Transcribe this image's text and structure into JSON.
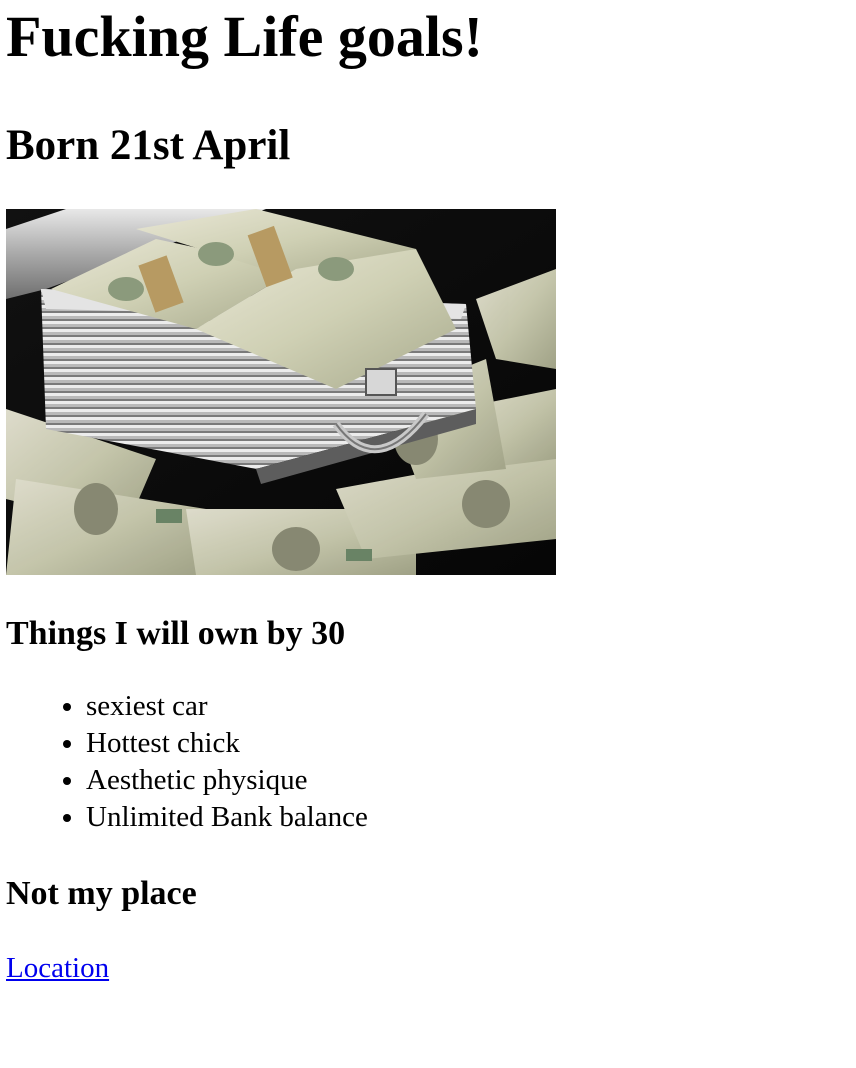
{
  "header": {
    "title": "Fucking Life goals!",
    "subtitle": "Born 21st April"
  },
  "hero_image": {
    "icon": "money-briefcase-image"
  },
  "own_section": {
    "heading": "Things I will own by 30",
    "items": [
      "sexiest car",
      "Hottest chick",
      "Aesthetic physique",
      "Unlimited Bank balance"
    ]
  },
  "place_section": {
    "heading": "Not my place",
    "link_label": "Location"
  },
  "colors": {
    "link": "#0000ee",
    "text": "#000000",
    "background": "#ffffff"
  }
}
